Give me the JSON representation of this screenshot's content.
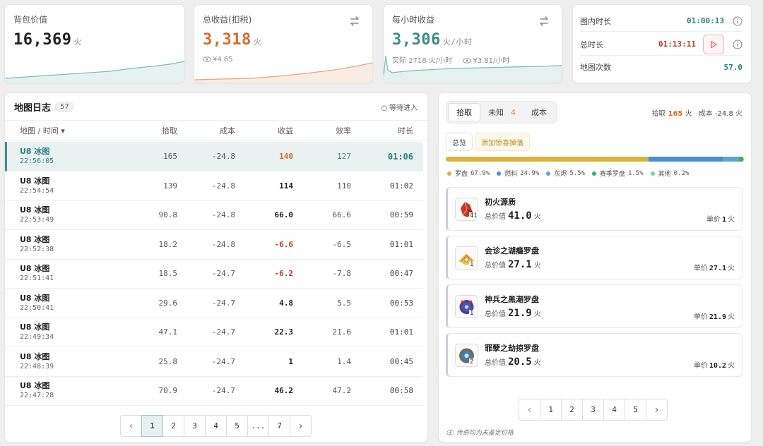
{
  "stats": {
    "bag_value": {
      "label": "背包价值",
      "value": "16,369",
      "unit": "火"
    },
    "total_income": {
      "label": "总收益(扣税)",
      "value": "3,318",
      "unit": "火",
      "sub": "¥4.65",
      "color": "#d46b2c"
    },
    "hourly_income": {
      "label": "每小时收益",
      "value": "3,306",
      "unit": "火/小时",
      "actual": "实际 2718 火/小时",
      "sub": "¥3.81/小时",
      "color": "#3a8c86"
    }
  },
  "timers": {
    "in_map_label": "图内时长",
    "in_map_value": "01:00:13",
    "total_label": "总时长",
    "total_value": "01:13:11",
    "maps_label": "地图次数",
    "maps_value": "57.0"
  },
  "log": {
    "title": "地图日志",
    "count": "57",
    "status": "○ 等待进入",
    "columns": [
      "地图 / 时间 ▾",
      "拾取",
      "成本",
      "收益",
      "效率",
      "时长"
    ],
    "rows": [
      {
        "map": "U8 冰图",
        "time": "22:56:05",
        "pickup": "165",
        "cost": "-24.8",
        "income": "140",
        "eff": "127",
        "dur": "01:06",
        "income_color": "#d46b2c"
      },
      {
        "map": "U8 冰图",
        "time": "22:54:54",
        "pickup": "139",
        "cost": "-24.8",
        "income": "114",
        "eff": "110",
        "dur": "01:02",
        "income_color": "#222"
      },
      {
        "map": "U8 冰图",
        "time": "22:53:49",
        "pickup": "90.8",
        "cost": "-24.8",
        "income": "66.0",
        "eff": "66.6",
        "dur": "00:59",
        "income_color": "#222"
      },
      {
        "map": "U8 冰图",
        "time": "22:52:38",
        "pickup": "18.2",
        "cost": "-24.8",
        "income": "-6.6",
        "eff": "-6.5",
        "dur": "01:01",
        "income_color": "#c0392b"
      },
      {
        "map": "U8 冰图",
        "time": "22:51:41",
        "pickup": "18.5",
        "cost": "-24.7",
        "income": "-6.2",
        "eff": "-7.8",
        "dur": "00:47",
        "income_color": "#c0392b"
      },
      {
        "map": "U8 冰图",
        "time": "22:50:41",
        "pickup": "29.6",
        "cost": "-24.7",
        "income": "4.8",
        "eff": "5.5",
        "dur": "00:53",
        "income_color": "#222"
      },
      {
        "map": "U8 冰图",
        "time": "22:49:34",
        "pickup": "47.1",
        "cost": "-24.7",
        "income": "22.3",
        "eff": "21.6",
        "dur": "01:01",
        "income_color": "#222"
      },
      {
        "map": "U8 冰图",
        "time": "22:48:39",
        "pickup": "25.8",
        "cost": "-24.7",
        "income": "1",
        "eff": "1.4",
        "dur": "00:45",
        "income_color": "#222"
      },
      {
        "map": "U8 冰图",
        "time": "22:47:28",
        "pickup": "70.9",
        "cost": "-24.7",
        "income": "46.2",
        "eff": "47.2",
        "dur": "00:58",
        "income_color": "#222"
      }
    ],
    "pages": [
      "1",
      "2",
      "3",
      "4",
      "5",
      "...",
      "7"
    ],
    "current_page": "1"
  },
  "drops": {
    "tabs": {
      "pickup": "拾取",
      "unknown": "未知",
      "unknown_count": "4",
      "cost": "成本"
    },
    "summary": {
      "pickup_label": "拾取",
      "pickup_value": "165",
      "cost_label": "成本",
      "cost_value": "-24.8",
      "unit": "火"
    },
    "subtabs": {
      "overview": "总览",
      "add_surprise": "添加惊喜掉落"
    },
    "distribution": [
      {
        "name": "罗盘",
        "pct": "67.9%",
        "fraction": 0.679,
        "color": "#d9b23c"
      },
      {
        "name": "燃料",
        "pct": "24.9%",
        "fraction": 0.249,
        "color": "#4a8fd0"
      },
      {
        "name": "灰烬",
        "pct": "5.5%",
        "fraction": 0.055,
        "color": "#5aa8c8"
      },
      {
        "name": "赛季罗盘",
        "pct": "1.5%",
        "fraction": 0.015,
        "color": "#3daa6e"
      },
      {
        "name": "其他",
        "pct": "0.2%",
        "fraction": 0.002,
        "color": "#86c9a4"
      }
    ],
    "total_label": "总价值",
    "unit_label": "单价",
    "unit": "火",
    "items": [
      {
        "name": "初火源质",
        "qty": "41",
        "total": "41.0",
        "unit_price": "1",
        "icon": "red-crystal-icon"
      },
      {
        "name": "会诊之湖瘾罗盘",
        "qty": "1",
        "total": "27.1",
        "unit_price": "27.1",
        "icon": "gold-compass-icon"
      },
      {
        "name": "神兵之黑潮罗盘",
        "qty": "1",
        "total": "21.9",
        "unit_price": "21.9",
        "icon": "purple-compass-icon"
      },
      {
        "name": "罪孽之劫掠罗盘",
        "qty": "2",
        "total": "20.5",
        "unit_price": "10.2",
        "icon": "blue-compass-icon"
      }
    ],
    "pages": [
      "1",
      "2",
      "3",
      "4",
      "5"
    ],
    "footnote": "注: 传奇均为未鉴定价格"
  }
}
